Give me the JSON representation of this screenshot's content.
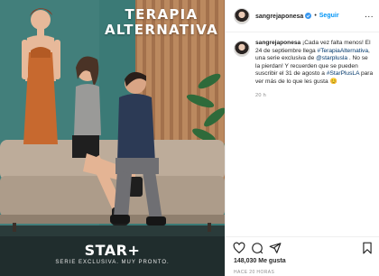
{
  "poster": {
    "title_line1": "TERAPIA",
    "title_line2": "ALTERNATIVA",
    "logo": "STAR+",
    "tagline": "SERIE EXCLUSIVA. MUY PRONTO."
  },
  "header": {
    "username": "sangrejaponesa",
    "verified": true,
    "separator": "•",
    "follow_label": "Seguir",
    "more_label": "..."
  },
  "caption": {
    "username": "sangrejaponesa",
    "part1": " ¡Cada vez falta menos! El 24 de septiembre llega ",
    "hashtag1": "#TerapiaAlternativa",
    "part2": ", una serie exclusiva de ",
    "mention": "@starplusla",
    "part3": " . No se la pierdan! Y recuerden que se pueden suscribir el 31 de agosto a ",
    "hashtag2": "#StarPlusLA",
    "part4": " para ver más de lo que les gusta 😊",
    "time_ago": "20 h"
  },
  "footer": {
    "likes": "148,030 Me gusta",
    "post_time": "HACE 20 HORAS"
  },
  "colors": {
    "poster_teal": "#3d7d79",
    "sofa": "#b9a897",
    "follow_blue": "#0095f6",
    "link_navy": "#00376b"
  },
  "icons": [
    "verified-badge-icon",
    "more-options-icon",
    "heart-icon",
    "comment-icon",
    "share-icon",
    "bookmark-icon",
    "star-plus-logo"
  ]
}
